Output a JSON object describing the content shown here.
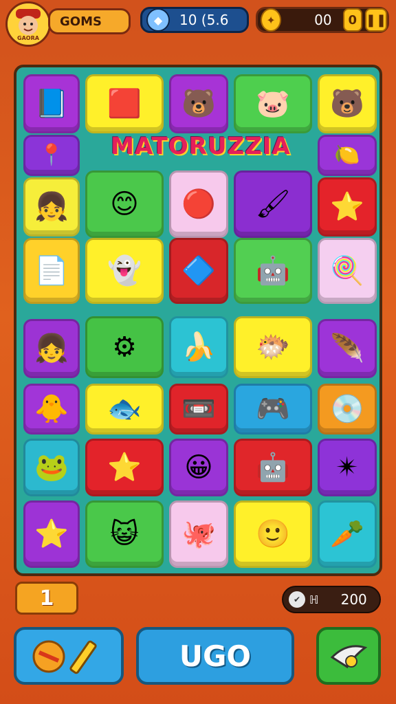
{
  "topbar": {
    "avatar_icon": "player-face-icon",
    "avatar_caption": "GAORA",
    "games_label": "GOMS",
    "gems_value": "10 (5.6",
    "coins_value": "00",
    "coins_extra": "0",
    "pause_icon": "pause-icon"
  },
  "board": {
    "title": "MATORUZZIA",
    "tiles": [
      {
        "glyph": "📘",
        "color": "#a733d6",
        "name": "notebook-icon"
      },
      {
        "glyph": "🟥",
        "color": "#fff02a",
        "name": "arcade-machine-icon"
      },
      {
        "glyph": "🐻",
        "color": "#a733d6",
        "name": "bear-face-icon"
      },
      {
        "glyph": "🐷",
        "color": "#4ecf4e",
        "name": "pig-face-icon"
      },
      {
        "glyph": "🐻",
        "color": "#fff02a",
        "name": "teddy-bear-icon"
      },
      {
        "glyph": "📍",
        "color": "#8b34d8",
        "name": "red-arrow-icon"
      },
      {
        "glyph": "🍋",
        "color": "#9a35d8",
        "name": "lemon-slice-icon"
      },
      {
        "glyph": "👧",
        "color": "#f6ee3a",
        "name": "girl-face-icon"
      },
      {
        "glyph": "😊",
        "color": "#4bc84b",
        "name": "smiley-sun-icon"
      },
      {
        "glyph": "🔴",
        "color": "#f7c9ec",
        "name": "orange-ball-icon"
      },
      {
        "glyph": "🖌",
        "color": "#8b2ed0",
        "name": "pencil-hook-icon"
      },
      {
        "glyph": "⭐",
        "color": "#e4232a",
        "name": "star-face-icon"
      },
      {
        "glyph": "📄",
        "color": "#ffd12a",
        "name": "paper-stack-icon"
      },
      {
        "glyph": "👻",
        "color": "#fff02a",
        "name": "cloud-monster-icon"
      },
      {
        "glyph": "🔷",
        "color": "#d8262a",
        "name": "blue-cone-icon"
      },
      {
        "glyph": "🤖",
        "color": "#52cf52",
        "name": "robot-box-icon"
      },
      {
        "glyph": "🍭",
        "color": "#f5cff0",
        "name": "green-lollipop-icon"
      },
      {
        "glyph": "👧",
        "color": "#9c33d4",
        "name": "girl-heart-icon"
      },
      {
        "glyph": "⚙",
        "color": "#45c245",
        "name": "gear-ring-icon"
      },
      {
        "glyph": "🍌",
        "color": "#2cc3d3",
        "name": "banana-icon"
      },
      {
        "glyph": "🐡",
        "color": "#fff02a",
        "name": "blue-puffball-icon"
      },
      {
        "glyph": "🪶",
        "color": "#9d34d8",
        "name": "feather-icon"
      },
      {
        "glyph": "🐥",
        "color": "#a135d8",
        "name": "chick-icon"
      },
      {
        "glyph": "🐟",
        "color": "#fff02a",
        "name": "fish-icon"
      },
      {
        "glyph": "📼",
        "color": "#e0242a",
        "name": "cassette-icon"
      },
      {
        "glyph": "🎮",
        "color": "#2aa6df",
        "name": "console-icon"
      },
      {
        "glyph": "💿",
        "color": "#f49a20",
        "name": "blue-disc-icon"
      },
      {
        "glyph": "🐸",
        "color": "#2cb9cf",
        "name": "green-frog-icon"
      },
      {
        "glyph": "⭐",
        "color": "#e3232a",
        "name": "pink-star-icon"
      },
      {
        "glyph": "😀",
        "color": "#9a34d6",
        "name": "smiley-cat-icon"
      },
      {
        "glyph": "🤖",
        "color": "#e0262a",
        "name": "robot-bin-icon"
      },
      {
        "glyph": "✴",
        "color": "#8e33d8",
        "name": "sparkle-star-icon"
      },
      {
        "glyph": "⭐",
        "color": "#9d33d6",
        "name": "red-star-icon"
      },
      {
        "glyph": "😺",
        "color": "#4ac84a",
        "name": "cat-face-icon"
      },
      {
        "glyph": "🐙",
        "color": "#f7c9ec",
        "name": "octopus-icon"
      },
      {
        "glyph": "🙂",
        "color": "#fff02a",
        "name": "smiley-face-icon"
      },
      {
        "glyph": "🥕",
        "color": "#2cc4d4",
        "name": "carrot-icon"
      }
    ]
  },
  "bottom": {
    "level_value": "1",
    "score_prefix": "ℍ",
    "score_value": "200",
    "go_label": "UGO"
  }
}
